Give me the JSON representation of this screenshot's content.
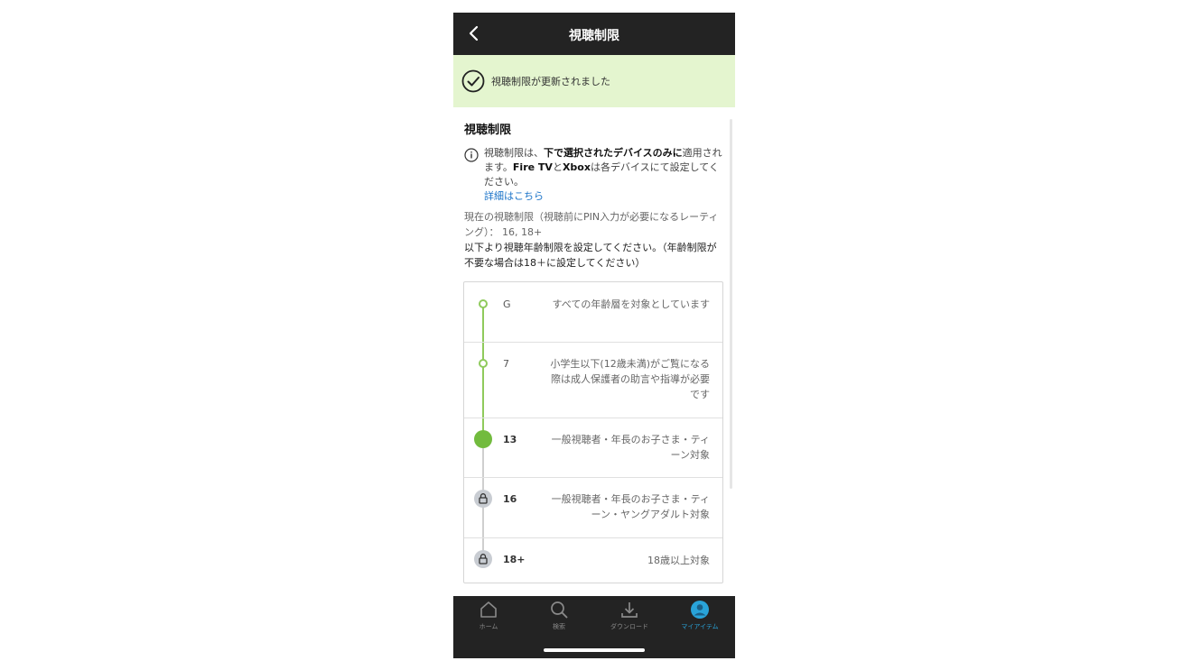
{
  "header": {
    "title": "視聴制限"
  },
  "banner": {
    "message": "視聴制限が更新されました"
  },
  "section": {
    "title": "視聴制限",
    "info_pre": "視聴制限は、",
    "info_bold1": "下で選択されたデバイスのみに",
    "info_mid1": "適用されます。",
    "info_bold2": "Fire TV",
    "info_mid2": "と",
    "info_bold3": "Xbox",
    "info_post": "は各デバイスにて設定してください。",
    "link": "詳細はこちら",
    "current": "現在の視聴制限（視聴前にPIN入力が必要になるレーティング）： 16, 18+",
    "instruction": "以下より視聴年齢制限を設定してください。（年齢制限が不要な場合は18＋に設定してください）"
  },
  "ratings": [
    {
      "label": "G",
      "description": "すべての年齢層を対象としています",
      "state": "open"
    },
    {
      "label": "7",
      "description": "小学生以下(12歳未満)がご覧になる際は成人保護者の助言や指導が必要です",
      "state": "open"
    },
    {
      "label": "13",
      "description": "一般視聴者・年長のお子さま・ティーン対象",
      "state": "selected"
    },
    {
      "label": "16",
      "description": "一般視聴者・年長のお子さま・ティーン・ヤングアダルト対象",
      "state": "locked"
    },
    {
      "label": "18+",
      "description": "18歳以上対象",
      "state": "locked"
    }
  ],
  "tabs": [
    {
      "label": "ホーム",
      "icon": "home-icon",
      "active": false
    },
    {
      "label": "検索",
      "icon": "search-icon",
      "active": false
    },
    {
      "label": "ダウンロード",
      "icon": "download-icon",
      "active": false
    },
    {
      "label": "マイアイテム",
      "icon": "profile-icon",
      "active": true
    }
  ],
  "colors": {
    "header_bg": "#232323",
    "banner_bg": "#e4f5cf",
    "track_green": "#8fca5c",
    "selected_dot": "#72bb3e",
    "link": "#1a73c8",
    "active_tab": "#29a3d8"
  }
}
